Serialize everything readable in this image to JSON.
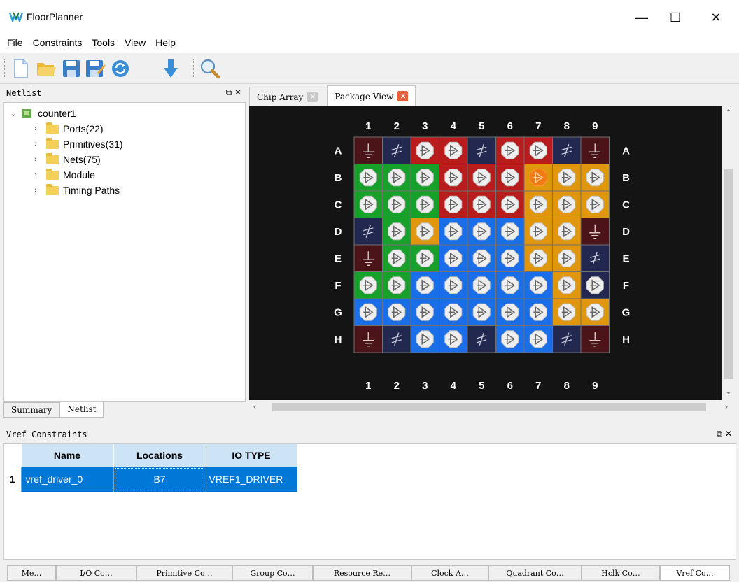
{
  "window": {
    "title": "FloorPlanner",
    "controls": [
      "—",
      "☐",
      "✕"
    ]
  },
  "menu": {
    "items": [
      "File",
      "Constraints",
      "Tools",
      "View",
      "Help"
    ]
  },
  "toolbar": {
    "icons": [
      "new-file-icon",
      "open-folder-icon",
      "save-icon",
      "save-as-icon",
      "refresh-icon",
      "download-icon",
      "search-icon"
    ]
  },
  "netlist": {
    "header": "Netlist",
    "root": "counter1",
    "items": [
      "Ports(22)",
      "Primitives(31)",
      "Nets(75)",
      "Module",
      "Timing Paths"
    ],
    "tabs": [
      "Summary",
      "Netlist"
    ]
  },
  "view_tabs": [
    {
      "label": "Chip Array",
      "close_color": "#c8c8c8"
    },
    {
      "label": "Package View",
      "close_color": "#e8603c"
    }
  ],
  "package": {
    "columns": [
      "1",
      "2",
      "3",
      "4",
      "5",
      "6",
      "7",
      "8",
      "9"
    ],
    "rows": [
      "A",
      "B",
      "C",
      "D",
      "E",
      "F",
      "G",
      "H"
    ],
    "colors": {
      "r": "#b81c1c",
      "g": "#17a02a",
      "o": "#e0960d",
      "b": "#1a6ee8",
      "n": "#232850",
      "m": "#4a1418",
      "bg": "#141414"
    },
    "grid": [
      [
        "mgnd",
        "npwr",
        "rio",
        "rio",
        "npwr",
        "rio",
        "rioc",
        "npwr",
        "mgnd"
      ],
      [
        "gio",
        "gio",
        "gio",
        "rio",
        "rio",
        "rio",
        "osel",
        "oio",
        "oio"
      ],
      [
        "gio",
        "gio",
        "gio",
        "rio",
        "rio",
        "rio",
        "oio",
        "oio",
        "oio"
      ],
      [
        "npwr",
        "gio",
        "oio",
        "bio",
        "bio",
        "bio",
        "oio",
        "oio",
        "mgnd"
      ],
      [
        "mgnd",
        "gio",
        "gio",
        "bio",
        "bio",
        "bio",
        "oio",
        "oio",
        "npwr"
      ],
      [
        "gio",
        "gio",
        "bio",
        "bio",
        "bio",
        "bio",
        "bio",
        "oio",
        "nio"
      ],
      [
        "bio",
        "bio",
        "bio",
        "bio",
        "bio",
        "bio",
        "bio",
        "oio",
        "oio"
      ],
      [
        "mgnd",
        "npwr",
        "bio",
        "bio",
        "npwr",
        "bio",
        "bio",
        "npwr",
        "mgnd"
      ]
    ]
  },
  "vref": {
    "header": "Vref Constraints",
    "columns": [
      "Name",
      "Locations",
      "IO TYPE"
    ],
    "rows": [
      {
        "index": "1",
        "name": "vref_driver_0",
        "location": "B7",
        "io_type": "VREF1_DRIVER"
      }
    ]
  },
  "bottom_tabs": [
    "Me…",
    "I/O Co…",
    "Primitive Co…",
    "Group Co…",
    "Resource Re…",
    "Clock A…",
    "Quadrant Co…",
    "Hclk Co…",
    "Vref Co…"
  ]
}
